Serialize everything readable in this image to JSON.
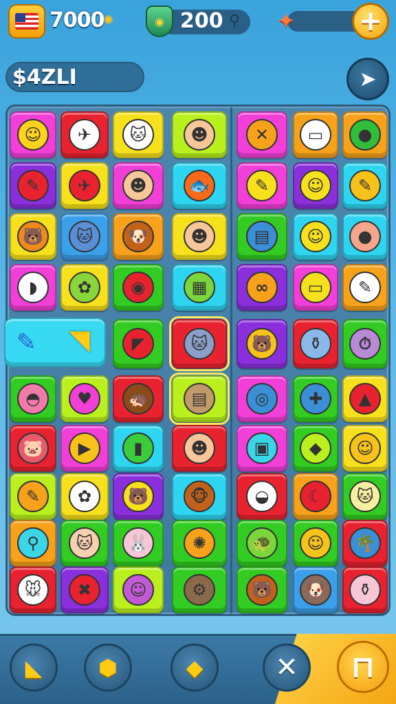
{
  "hud": {
    "coins": "7000",
    "gems": "200",
    "score_label": "$4ZLI"
  },
  "colors": {
    "pink": "#f23fd8",
    "red": "#e8232f",
    "yellow": "#f7e01c",
    "cyan": "#2ed5f0",
    "purple": "#8b2fdc",
    "green": "#33cc22",
    "orange": "#f7a21a",
    "lime": "#b9f01e",
    "blue": "#3aa0ea"
  },
  "board": {
    "wide_tile_items": [
      "pencil-icon",
      "banana-icon"
    ],
    "tiles": [
      {
        "row": 0,
        "col": 0,
        "color": "pink",
        "glyph": "☺",
        "glyph_color": "#ffd21c",
        "name": "smiley-face-icon"
      },
      {
        "row": 0,
        "col": 1,
        "color": "red",
        "glyph": "✈",
        "glyph_color": "#ffffff",
        "name": "airplane-icon"
      },
      {
        "row": 0,
        "col": 2,
        "color": "yellow",
        "glyph": "🐱",
        "glyph_color": "#ffffff",
        "name": "cat-face-icon"
      },
      {
        "row": 0,
        "col": 3,
        "color": "lime",
        "glyph": "☻",
        "glyph_color": "#f7c79a",
        "name": "redhead-girl-icon"
      },
      {
        "row": 0,
        "col": 4,
        "color": "pink",
        "glyph": "✕",
        "glyph_color": "#f7a21a",
        "name": "orange-x-icon"
      },
      {
        "row": 0,
        "col": 5,
        "color": "orange",
        "glyph": "▭",
        "glyph_color": "#ffffff",
        "name": "id-card-icon"
      },
      {
        "row": 0,
        "col": 6,
        "color": "orange",
        "glyph": "●",
        "glyph_color": "#2fbf3a",
        "name": "green-apple-icon"
      },
      {
        "row": 1,
        "col": 0,
        "color": "purple",
        "glyph": "✎",
        "glyph_color": "#e8232f",
        "name": "red-crayon-icon"
      },
      {
        "row": 1,
        "col": 1,
        "color": "yellow",
        "glyph": "✈",
        "glyph_color": "#e8232f",
        "name": "red-plane-icon"
      },
      {
        "row": 1,
        "col": 2,
        "color": "pink",
        "glyph": "☻",
        "glyph_color": "#f7c79a",
        "name": "brunette-girl-icon"
      },
      {
        "row": 1,
        "col": 3,
        "color": "cyan",
        "glyph": "🐟",
        "glyph_color": "#f76a1a",
        "name": "orange-fish-icon"
      },
      {
        "row": 1,
        "col": 4,
        "color": "pink",
        "glyph": "✎",
        "glyph_color": "#f7e01c",
        "name": "feather-paper-icon"
      },
      {
        "row": 1,
        "col": 5,
        "color": "purple",
        "glyph": "☺",
        "glyph_color": "#f7e01c",
        "name": "yellow-face-icon"
      },
      {
        "row": 1,
        "col": 6,
        "color": "cyan",
        "glyph": "✎",
        "glyph_color": "#f7c21a",
        "name": "yellow-pencil-icon"
      },
      {
        "row": 2,
        "col": 0,
        "color": "yellow",
        "glyph": "🐻",
        "glyph_color": "#f08a1a",
        "name": "bear-face-icon"
      },
      {
        "row": 2,
        "col": 1,
        "color": "blue",
        "glyph": "🐱",
        "glyph_color": "#5a8fd6",
        "name": "blue-cat-icon"
      },
      {
        "row": 2,
        "col": 2,
        "color": "orange",
        "glyph": "🐶",
        "glyph_color": "#c2621a",
        "name": "dog-face-icon"
      },
      {
        "row": 2,
        "col": 3,
        "color": "yellow",
        "glyph": "☻",
        "glyph_color": "#f7c79a",
        "name": "blonde-girl-icon"
      },
      {
        "row": 2,
        "col": 4,
        "color": "green",
        "glyph": "▤",
        "glyph_color": "#3a8fd6",
        "name": "books-icon"
      },
      {
        "row": 2,
        "col": 5,
        "color": "cyan",
        "glyph": "☺",
        "glyph_color": "#f7e01c",
        "name": "chick-icon"
      },
      {
        "row": 2,
        "col": 6,
        "color": "cyan",
        "glyph": "●",
        "glyph_color": "#f4a58a",
        "name": "peach-face-icon"
      },
      {
        "row": 3,
        "col": 0,
        "color": "pink",
        "glyph": "◗",
        "glyph_color": "#ffffff",
        "name": "white-leaf-icon"
      },
      {
        "row": 3,
        "col": 1,
        "color": "yellow",
        "glyph": "✿",
        "glyph_color": "#8ad63a",
        "name": "leaf-bundle-icon"
      },
      {
        "row": 3,
        "col": 2,
        "color": "green",
        "glyph": "◉",
        "glyph_color": "#e8232f",
        "name": "seashell-icon"
      },
      {
        "row": 3,
        "col": 3,
        "color": "cyan",
        "glyph": "▦",
        "glyph_color": "#7ad63a",
        "name": "train-icon"
      },
      {
        "row": 3,
        "col": 4,
        "color": "purple",
        "glyph": "∞",
        "glyph_color": "#f7a21a",
        "name": "rings-icon"
      },
      {
        "row": 3,
        "col": 5,
        "color": "pink",
        "glyph": "▭",
        "glyph_color": "#f7e01c",
        "name": "radio-icon"
      },
      {
        "row": 3,
        "col": 6,
        "color": "orange",
        "glyph": "✎",
        "glyph_color": "#ffffff",
        "name": "brown-pencil-icon"
      },
      {
        "row": 4,
        "col": 2,
        "color": "green",
        "glyph": "◤",
        "glyph_color": "#e8232f",
        "name": "red-scarf-icon"
      },
      {
        "row": 4,
        "col": 3,
        "color": "red",
        "glyph": "🐱",
        "glyph_color": "#8aa0c8",
        "name": "gray-cat-icon",
        "selected": true
      },
      {
        "row": 4,
        "col": 4,
        "color": "purple",
        "glyph": "🐻",
        "glyph_color": "#f7c21a",
        "name": "yellow-bear-icon"
      },
      {
        "row": 4,
        "col": 5,
        "color": "red",
        "glyph": "⚱",
        "glyph_color": "#8ab8e8",
        "name": "jar-icon"
      },
      {
        "row": 4,
        "col": 6,
        "color": "green",
        "glyph": "⏱",
        "glyph_color": "#b98ad6",
        "name": "stopwatch-icon"
      },
      {
        "row": 5,
        "col": 0,
        "color": "green",
        "glyph": "◓",
        "glyph_color": "#f27aa8",
        "name": "pink-blob-icon"
      },
      {
        "row": 5,
        "col": 1,
        "color": "lime",
        "glyph": "♥",
        "glyph_color": "#f23fd8",
        "name": "heart-icon"
      },
      {
        "row": 5,
        "col": 2,
        "color": "red",
        "glyph": "🦔",
        "glyph_color": "#8a4a1a",
        "name": "hedgehog-icon"
      },
      {
        "row": 5,
        "col": 3,
        "color": "lime",
        "glyph": "▤",
        "glyph_color": "#c29a6a",
        "name": "keyboard-icon",
        "selected": true
      },
      {
        "row": 5,
        "col": 4,
        "color": "pink",
        "glyph": "◎",
        "glyph_color": "#3a8fd6",
        "name": "blue-fish-icon"
      },
      {
        "row": 5,
        "col": 5,
        "color": "green",
        "glyph": "✚",
        "glyph_color": "#3a8fd6",
        "name": "bandage-icon"
      },
      {
        "row": 5,
        "col": 6,
        "color": "yellow",
        "glyph": "▲",
        "glyph_color": "#e8232f",
        "name": "watermelon-icon"
      },
      {
        "row": 6,
        "col": 0,
        "color": "red",
        "glyph": "🐷",
        "glyph_color": "#e85a6a",
        "name": "red-critter-icon"
      },
      {
        "row": 6,
        "col": 1,
        "color": "pink",
        "glyph": "▶",
        "glyph_color": "#f7c21a",
        "name": "pizza-slice-icon"
      },
      {
        "row": 6,
        "col": 2,
        "color": "cyan",
        "glyph": "▮",
        "glyph_color": "#3acc3a",
        "name": "green-blocks-icon"
      },
      {
        "row": 6,
        "col": 3,
        "color": "red",
        "glyph": "☻",
        "glyph_color": "#f7c79a",
        "name": "girl-bangs-icon"
      },
      {
        "row": 6,
        "col": 4,
        "color": "pink",
        "glyph": "▣",
        "glyph_color": "#3ad6e8",
        "name": "photo-card-icon"
      },
      {
        "row": 6,
        "col": 5,
        "color": "green",
        "glyph": "◆",
        "glyph_color": "#b9f01e",
        "name": "green-diamond-icon"
      },
      {
        "row": 6,
        "col": 6,
        "color": "yellow",
        "glyph": "☺",
        "glyph_color": "#f7c21a",
        "name": "yellow-blob-icon"
      },
      {
        "row": 7,
        "col": 0,
        "color": "lime",
        "glyph": "✎",
        "glyph_color": "#f7a21a",
        "name": "orange-pencil-icon"
      },
      {
        "row": 7,
        "col": 1,
        "color": "yellow",
        "glyph": "✿",
        "glyph_color": "#ffffff",
        "name": "white-flower-icon"
      },
      {
        "row": 7,
        "col": 2,
        "color": "purple",
        "glyph": "🐻",
        "glyph_color": "#f7e01c",
        "name": "yellow-teddy-icon"
      },
      {
        "row": 7,
        "col": 3,
        "color": "cyan",
        "glyph": "🐵",
        "glyph_color": "#c2621a",
        "name": "monkey-face-icon"
      },
      {
        "row": 7,
        "col": 4,
        "color": "red",
        "glyph": "◒",
        "glyph_color": "#ffffff",
        "name": "white-shell-icon"
      },
      {
        "row": 7,
        "col": 5,
        "color": "orange",
        "glyph": "☾",
        "glyph_color": "#e8232f",
        "name": "red-pepper-icon"
      },
      {
        "row": 7,
        "col": 6,
        "color": "green",
        "glyph": "🐱",
        "glyph_color": "#f7f0a0",
        "name": "cream-cat-icon"
      },
      {
        "row": 8,
        "col": 0,
        "color": "orange",
        "glyph": "⚲",
        "glyph_color": "#3ad6e8",
        "name": "balloon-icon"
      },
      {
        "row": 8,
        "col": 1,
        "color": "green",
        "glyph": "🐱",
        "glyph_color": "#f7d0b0",
        "name": "fox-face-icon"
      },
      {
        "row": 8,
        "col": 2,
        "color": "green",
        "glyph": "🐰",
        "glyph_color": "#f7c7d8",
        "name": "pink-bunny-icon"
      },
      {
        "row": 8,
        "col": 3,
        "color": "green",
        "glyph": "✺",
        "glyph_color": "#f7a21a",
        "name": "sun-flower-icon"
      },
      {
        "row": 8,
        "col": 4,
        "color": "green",
        "glyph": "🐢",
        "glyph_color": "#7ad63a",
        "name": "turtle-icon"
      },
      {
        "row": 8,
        "col": 5,
        "color": "green",
        "glyph": "☺",
        "glyph_color": "#f7c21a",
        "name": "orange-chick-icon"
      },
      {
        "row": 8,
        "col": 6,
        "color": "red",
        "glyph": "🌴",
        "glyph_color": "#3a8fd6",
        "name": "palm-box-icon"
      },
      {
        "row": 9,
        "col": 0,
        "color": "red",
        "glyph": "🐭",
        "glyph_color": "#ffffff",
        "name": "white-mouse-icon"
      },
      {
        "row": 9,
        "col": 1,
        "color": "purple",
        "glyph": "✖",
        "glyph_color": "#e8232f",
        "name": "red-x-icon"
      },
      {
        "row": 9,
        "col": 2,
        "color": "lime",
        "glyph": "☺",
        "glyph_color": "#c25ad6",
        "name": "purple-face-icon"
      },
      {
        "row": 9,
        "col": 3,
        "color": "green",
        "glyph": "⚙",
        "glyph_color": "#8a6a4a",
        "name": "gadget-icon"
      },
      {
        "row": 9,
        "col": 4,
        "color": "green",
        "glyph": "🐻",
        "glyph_color": "#c2621a",
        "name": "brown-bear-icon"
      },
      {
        "row": 9,
        "col": 5,
        "color": "blue",
        "glyph": "🐶",
        "glyph_color": "#8a6a5a",
        "name": "brown-dog-icon"
      },
      {
        "row": 9,
        "col": 6,
        "color": "red",
        "glyph": "⚱",
        "glyph_color": "#f7c7d8",
        "name": "pink-bottle-icon"
      }
    ]
  },
  "bottom_bar": {
    "buttons": [
      {
        "name": "hammer-booster-button",
        "glyph": "◣"
      },
      {
        "name": "shuffle-booster-button",
        "glyph": "⬢"
      },
      {
        "name": "swap-booster-button",
        "glyph": "◆"
      }
    ],
    "close_glyph": "✕",
    "pause_glyph": "⊓"
  }
}
